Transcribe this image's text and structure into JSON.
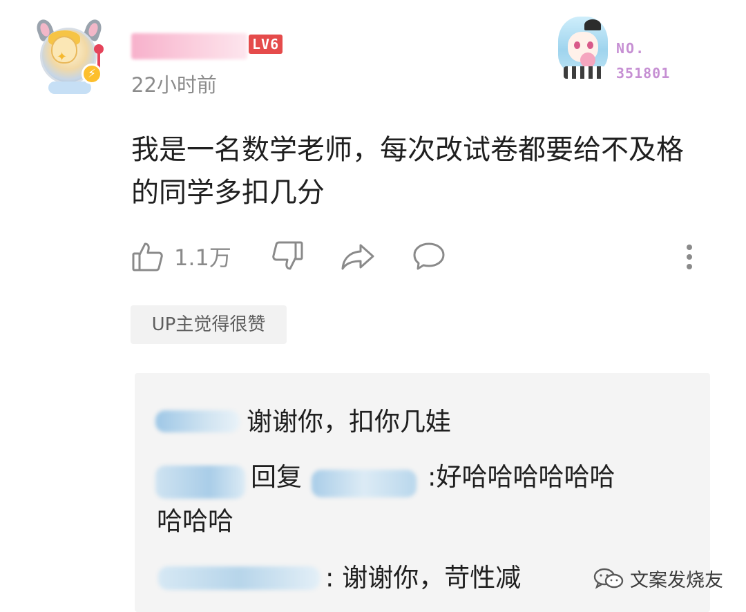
{
  "comment": {
    "level_badge": "LV6",
    "timestamp": "22小时前",
    "text": "我是一名数学老师，每次改试卷都要给不及格的同学多扣几分",
    "like_count": "1.1万",
    "up_tag": "UP主觉得很赞"
  },
  "fan_badge": {
    "no_label": "NO.",
    "number": "351801"
  },
  "replies": [
    {
      "text": "谢谢你，扣你几娃"
    },
    {
      "reply_word": "回复",
      "text_part1": ":好哈哈哈哈哈哈",
      "text_part2": "哈哈哈"
    },
    {
      "text": ": 谢谢你，苛性减"
    }
  ],
  "watermark": {
    "text": "文案发烧友"
  },
  "icons": {
    "like": "thumbs-up-icon",
    "dislike": "thumbs-down-icon",
    "share": "share-icon",
    "reply": "comment-icon",
    "more": "more-vertical-icon",
    "watermark": "wechat-icon"
  }
}
